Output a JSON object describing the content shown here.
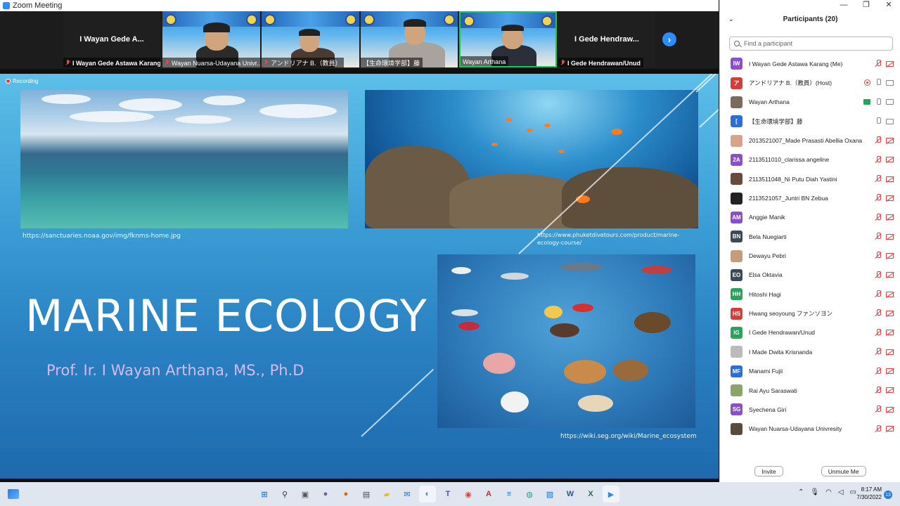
{
  "window": {
    "title": "Zoom Meeting"
  },
  "video_strip": {
    "tiles": [
      {
        "display": "I Wayan Gede A...",
        "caption": "I Wayan Gede Astawa Karang",
        "muted": true
      },
      {
        "caption": "Wayan Nuarsa-Udayana Univr...",
        "muted": true
      },
      {
        "caption": "アンドリアナ B.（教員）",
        "muted": true
      },
      {
        "caption": "【生命環境学部】藤",
        "muted": false
      },
      {
        "caption": "Wayan Arthana",
        "muted": false
      },
      {
        "display": "I Gede Hendraw...",
        "caption": "I Gede Hendrawan/Unud",
        "muted": true
      }
    ],
    "next_arrow": "›"
  },
  "share": {
    "recording_label": "Recording",
    "slide": {
      "title": "MARINE ECOLOGY",
      "subtitle": "Prof. Ir. I Wayan Arthana, MS., Ph.D",
      "credit_ocean": "https://sanctuaries.noaa.gov/img/fknms-home.jpg",
      "credit_reef": "https://www.phuketdivetours.com/product/marine-ecology-course/",
      "credit_web": "https://wiki.seg.org/wiki/Marine_ecosystem"
    }
  },
  "participants": {
    "header": "Participants (20)",
    "search_placeholder": "Find a participant",
    "list": [
      {
        "name": "I Wayan Gede Astawa Karang (Me)",
        "initials": "IW",
        "color": "#8a4fc9",
        "mic": "muted",
        "cam": "muted"
      },
      {
        "name": "アンドリアナ B.（教員）(Host)",
        "initials": "ア",
        "color": "#d0403a",
        "mic": "on",
        "cam": "on",
        "rec": true
      },
      {
        "name": "Wayan Arthana",
        "initials": "",
        "color": "#7c6a5a",
        "mic": "on",
        "cam": "on",
        "share": true
      },
      {
        "name": "【生命環境学部】藤",
        "initials": "[",
        "color": "#2a6fd6",
        "mic": "on",
        "cam": "on"
      },
      {
        "name": "2013521007_Made Prasasti Abellia Oxana",
        "initials": "",
        "color": "#d9a38a",
        "mic": "muted",
        "cam": "muted"
      },
      {
        "name": "2113511010_clarissa angeline",
        "initials": "2A",
        "color": "#8a4fc9",
        "mic": "muted",
        "cam": "muted"
      },
      {
        "name": "2113511048_Ni Putu Diah Yastini",
        "initials": "",
        "color": "#6a4a3a",
        "mic": "muted",
        "cam": "muted"
      },
      {
        "name": "2113521057_Juntri BN Zebua",
        "initials": "",
        "color": "#222222",
        "mic": "muted",
        "cam": "muted"
      },
      {
        "name": "Anggie Manik",
        "initials": "AM",
        "color": "#8a4fc9",
        "mic": "muted",
        "cam": "muted"
      },
      {
        "name": "Bela Nuegiarti",
        "initials": "BN",
        "color": "#3a4a5a",
        "mic": "muted",
        "cam": "muted"
      },
      {
        "name": "Dewayu Pebri",
        "initials": "",
        "color": "#c99a7a",
        "mic": "muted",
        "cam": "muted"
      },
      {
        "name": "Elsa Oktavia",
        "initials": "EO",
        "color": "#3a4a5a",
        "mic": "muted",
        "cam": "muted"
      },
      {
        "name": "Hitoshi Hagi",
        "initials": "HH",
        "color": "#23a55a",
        "mic": "muted",
        "cam": "muted"
      },
      {
        "name": "Hwang seoyoung ファンソヨン",
        "initials": "HS",
        "color": "#d0403a",
        "mic": "muted",
        "cam": "muted"
      },
      {
        "name": "I Gede Hendrawan/Unud",
        "initials": "IG",
        "color": "#23a55a",
        "mic": "muted",
        "cam": "muted"
      },
      {
        "name": "I Made Dwita Krisnanda",
        "initials": "",
        "color": "#bbbbbb",
        "mic": "muted",
        "cam": "muted"
      },
      {
        "name": "Manami Fujii",
        "initials": "MF",
        "color": "#2a6fd6",
        "mic": "muted",
        "cam": "muted"
      },
      {
        "name": "Rai Ayu Saraswati",
        "initials": "",
        "color": "#8aa46a",
        "mic": "muted",
        "cam": "muted"
      },
      {
        "name": "Syechena Giri",
        "initials": "SG",
        "color": "#8a4fc9",
        "mic": "muted",
        "cam": "muted"
      },
      {
        "name": "Wayan Nuarsa-Udayana Univresity",
        "initials": "",
        "color": "#5a4a3a",
        "mic": "muted",
        "cam": "muted"
      }
    ],
    "invite_label": "Invite",
    "unmute_label": "Unmute Me"
  },
  "taskbar": {
    "time": "8:17 AM",
    "date": "7/30/2022",
    "notifications": "13",
    "apps": [
      {
        "icon": "windows-start-icon",
        "glyph": "⊞",
        "color": "#2b79d8"
      },
      {
        "icon": "search-icon",
        "glyph": "⚲",
        "color": "#333333"
      },
      {
        "icon": "task-view-icon",
        "glyph": "▣",
        "color": "#555555"
      },
      {
        "icon": "teams-chat-icon",
        "glyph": "●",
        "color": "#6264a7"
      },
      {
        "icon": "firefox-icon",
        "glyph": "●",
        "color": "#e66000"
      },
      {
        "icon": "store-icon",
        "glyph": "▤",
        "color": "#4a4a4a"
      },
      {
        "icon": "file-explorer-icon",
        "glyph": "▰",
        "color": "#e8b93a"
      },
      {
        "icon": "mail-icon",
        "glyph": "✉",
        "color": "#1e6fd9"
      },
      {
        "icon": "edge-icon",
        "glyph": "◐",
        "color": "#1a8fd1"
      },
      {
        "icon": "teams-icon",
        "glyph": "T",
        "color": "#4b53bc"
      },
      {
        "icon": "chrome-icon",
        "glyph": "◉",
        "color": "#db4437"
      },
      {
        "icon": "acrobat-icon",
        "glyph": "A",
        "color": "#d6242a"
      },
      {
        "icon": "notepad-icon",
        "glyph": "≡",
        "color": "#2a6fd6"
      },
      {
        "icon": "globe-icon",
        "glyph": "◍",
        "color": "#2a9d8f"
      },
      {
        "icon": "photos-icon",
        "glyph": "▨",
        "color": "#1e6fd9"
      },
      {
        "icon": "word-icon",
        "glyph": "W",
        "color": "#2b579a"
      },
      {
        "icon": "excel-icon",
        "glyph": "X",
        "color": "#217346"
      },
      {
        "icon": "zoom-icon",
        "glyph": "▶",
        "color": "#2d8cff"
      }
    ]
  }
}
